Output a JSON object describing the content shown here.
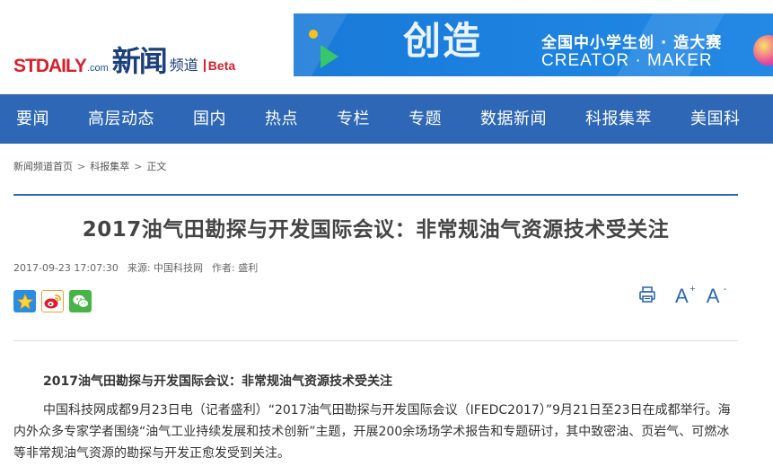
{
  "header": {
    "logo": {
      "brand": "STDAILY",
      "domain": ".com",
      "title": "新闻",
      "subtitle": "频道",
      "badge": "Beta"
    },
    "banner": {
      "main_text": "创造",
      "line1": "全国中小学生创 · 造大赛",
      "line2": "CREATOR · MAKER"
    }
  },
  "nav": {
    "items": [
      "要闻",
      "高层动态",
      "国内",
      "热点",
      "专栏",
      "专题",
      "数据新闻",
      "科报集萃",
      "美国科"
    ]
  },
  "breadcrumb": {
    "items": [
      "新闻频道首页",
      "科报集萃",
      "正文"
    ],
    "separator": ">"
  },
  "article": {
    "title": "2017油气田勘探与开发国际会议：非常规油气资源技术受关注",
    "date": "2017-09-23 17:07:30",
    "source": "来源: 中国科技网",
    "author": "作者: 盛利",
    "lead": "2017油气田勘探与开发国际会议：非常规油气资源技术受关注",
    "body": "中国科技网成都9月23日电（记者盛利）“2017油气田勘探与开发国际会议（IFEDC2017）”9月21日至23日在成都举行。海内外众多专家学者围绕“油气工业持续发展和技术创新”主题，开展200余场场学术报告和专题研讨，其中致密油、页岩气、可燃冰等非常规油气资源的勘探与开发正愈发受到关注。"
  },
  "tools": {
    "font_increase": "A",
    "font_increase_sup": "+",
    "font_decrease": "A",
    "font_decrease_sup": "-"
  },
  "colors": {
    "nav_bg": "#2d67b5",
    "brand_red": "#d71f2b",
    "brand_blue": "#1d4e9b"
  }
}
